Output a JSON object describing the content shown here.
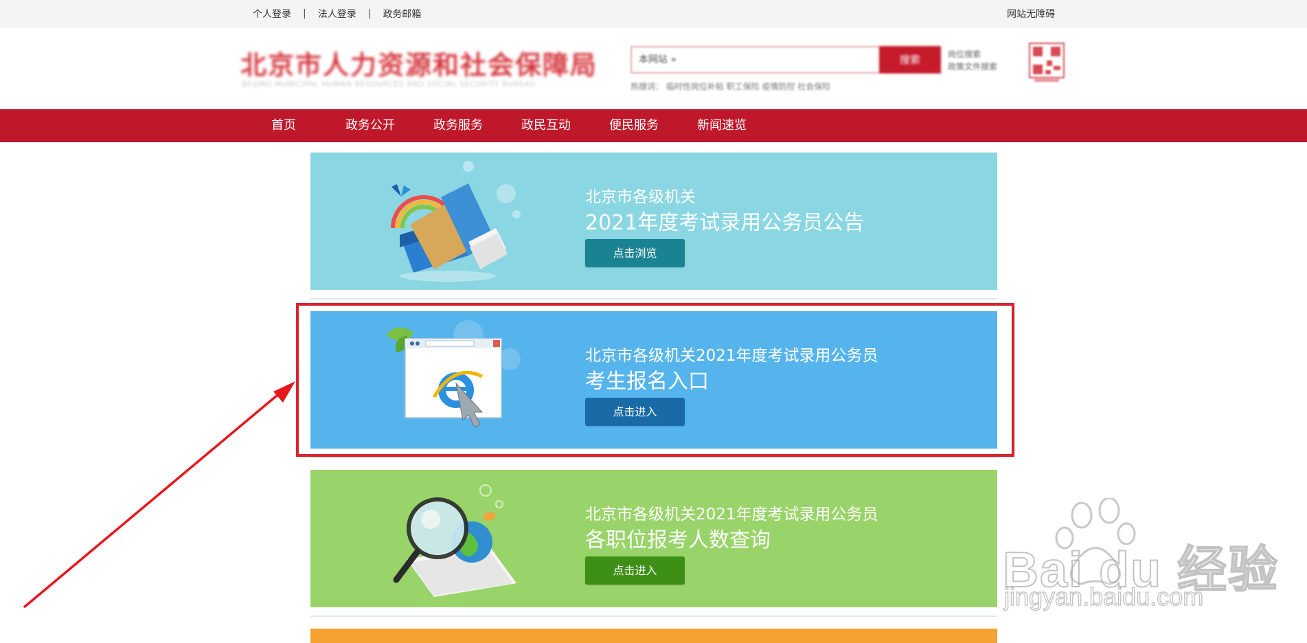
{
  "topbar": {
    "links": [
      "个人登录",
      "法人登录",
      "政务邮箱"
    ],
    "separator": "|",
    "accessibility": "网站无障碍"
  },
  "header": {
    "org_name": "北京市人力资源和社会保障局",
    "org_name_en": "BEIJING MUNICIPAL HUMAN RESOURCES AND SOCIAL SECURITY BUREAU",
    "search_placeholder": "本网站 »",
    "search_button": "搜索",
    "hot_words_label": "热搜词：",
    "hot_words": "临时性岗位补贴  职工保险  疫情防控  社会保险",
    "side_links": [
      "岗位搜索",
      "政策文件搜索"
    ]
  },
  "nav": {
    "items": [
      "首页",
      "政务公开",
      "政务服务",
      "政民互动",
      "便民服务",
      "新闻速览"
    ]
  },
  "banners": [
    {
      "line1": "北京市各级机关",
      "line2": "2021年度考试录用公务员公告",
      "button": "点击浏览",
      "bg": "#8ad6e3",
      "button_color": "#1a8392"
    },
    {
      "line1": "北京市各级机关2021年度考试录用公务员",
      "line2": "考生报名入口",
      "button": "点击进入",
      "bg": "#56b4ec",
      "button_color": "#1a6aa6"
    },
    {
      "line1": "北京市各级机关2021年度考试录用公务员",
      "line2": "各职位报考人数查询",
      "button": "点击进入",
      "bg": "#99d46a",
      "button_color": "#3d8f16"
    },
    {
      "bg": "#f5a233"
    }
  ],
  "watermark": {
    "brand": "Bai du 经验",
    "url": "jingyan.baidu.com"
  },
  "colors": {
    "nav_red": "#c0182b",
    "annotation_red": "#d9232d"
  }
}
